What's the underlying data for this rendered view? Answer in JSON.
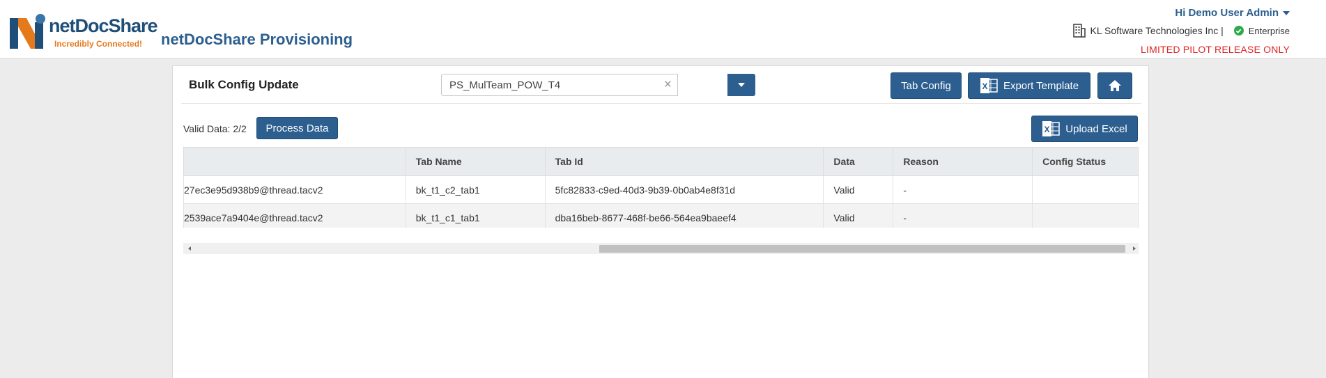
{
  "header": {
    "logo_name": "netDocShare",
    "logo_tagline": "Incredibly Connected!",
    "app_title": "netDocShare Provisioning",
    "user_greeting": "Hi Demo User Admin",
    "org_name": "KL Software Technologies Inc |",
    "plan": "Enterprise",
    "release_notice": "LIMITED PILOT RELEASE ONLY"
  },
  "page": {
    "title": "Bulk Config Update",
    "selected_value": "PS_MulTeam_POW_T4",
    "valid_label": "Valid Data: 2/2"
  },
  "buttons": {
    "tab_config": "Tab Config",
    "export_template": "Export Template",
    "upload_excel": "Upload Excel",
    "process_data": "Process Data"
  },
  "table": {
    "columns": [
      "",
      "Tab Name",
      "Tab Id",
      "Data",
      "Reason",
      "Config Status"
    ],
    "rows": [
      [
        "27ec3e95d938b9@thread.tacv2",
        "bk_t1_c2_tab1",
        "5fc82833-c9ed-40d3-9b39-0b0ab4e8f31d",
        "Valid",
        "-",
        ""
      ],
      [
        "2539ace7a9404e@thread.tacv2",
        "bk_t1_c1_tab1",
        "dba16beb-8677-468f-be66-564ea9baeef4",
        "Valid",
        "-",
        ""
      ]
    ]
  },
  "colors": {
    "primary": "#2c5f8f",
    "accent_orange": "#e57a1c",
    "alert_red": "#e02424",
    "success_green": "#2eaa4a"
  },
  "icons": [
    "logo-mark-icon",
    "building-icon",
    "check-circle-icon",
    "caret-down-icon",
    "excel-icon",
    "home-icon",
    "close-icon"
  ]
}
